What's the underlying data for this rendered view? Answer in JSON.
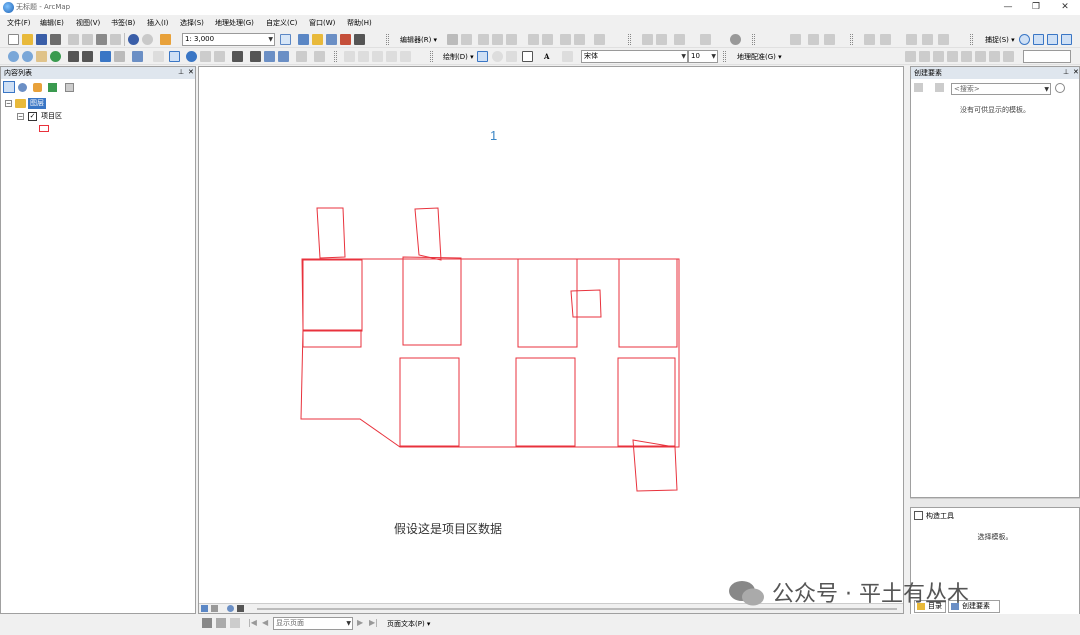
{
  "window": {
    "title": "无标题 - ArcMap"
  },
  "menu": [
    "文件(F)",
    "编辑(E)",
    "视图(V)",
    "书签(B)",
    "插入(I)",
    "选择(S)",
    "地理处理(G)",
    "自定义(C)",
    "窗口(W)",
    "帮助(H)"
  ],
  "toolbar1": {
    "scale": "1: 3,000",
    "editor_label": "编辑器(R) ▾",
    "snap_label": "捕捉(S) ▾"
  },
  "toolbar2": {
    "draw_label": "绘制(D) ▾",
    "font": "宋体",
    "font_size": "10",
    "georef_label": "地理配准(G) ▾"
  },
  "toc": {
    "title": "内容列表",
    "layers_group": "图层",
    "layer_name": "项目区"
  },
  "map": {
    "label_1": "1",
    "caption": "假设这是项目区数据",
    "polygon_color": "#e8323c"
  },
  "create_features": {
    "title": "创建要素",
    "search_placeholder": "<搜索>",
    "empty_message": "没有可供显示的模板。"
  },
  "construct_tools": {
    "title": "构造工具",
    "message": "选择模板。"
  },
  "tabs": {
    "catalog": "目录",
    "create_features": "创建要素"
  },
  "statusbar": {
    "page_combo": "显示页面",
    "page_text": "页面文本(P) ▾"
  },
  "watermark": "公众号 · 平土有丛木"
}
